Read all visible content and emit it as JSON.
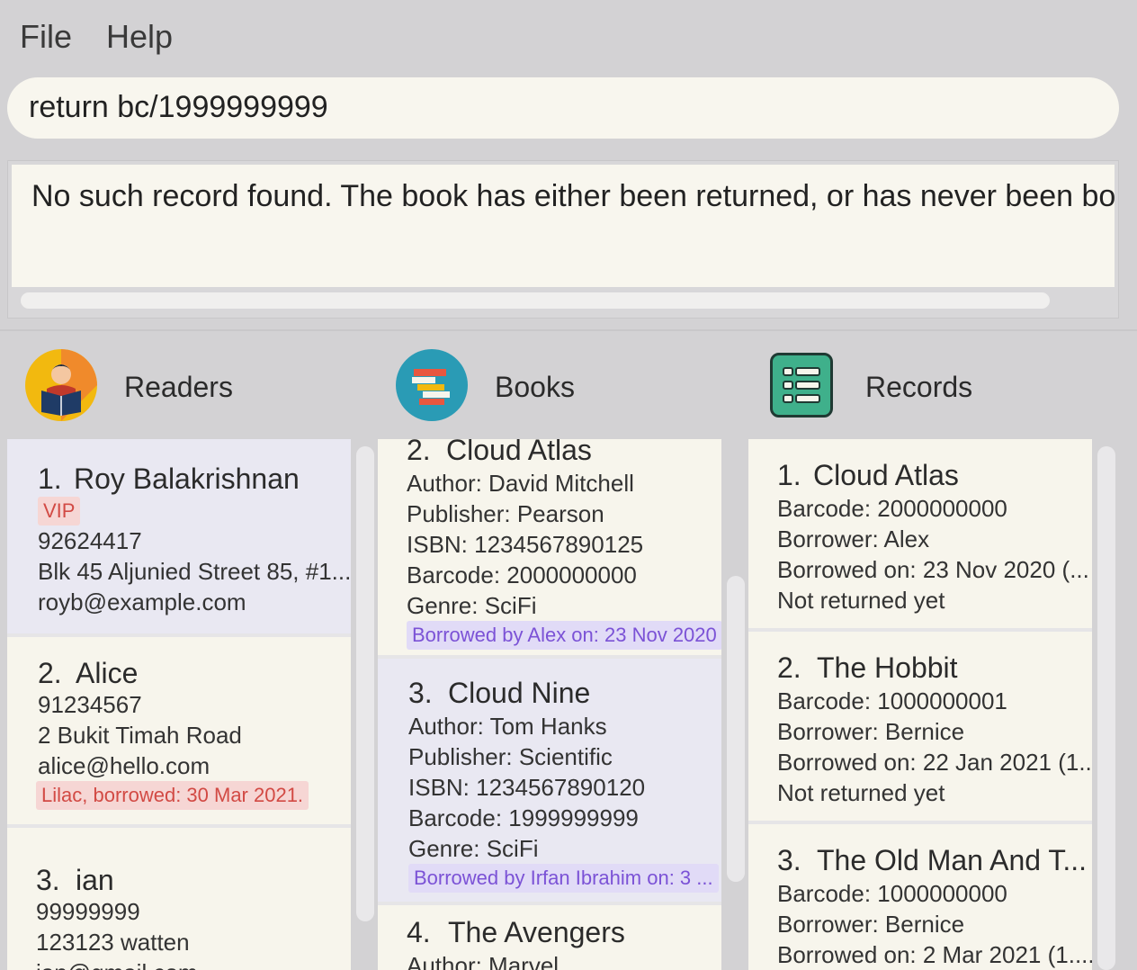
{
  "menu": {
    "file": "File",
    "help": "Help"
  },
  "command": {
    "value": "return bc/1999999999"
  },
  "result": {
    "text": "No such record found. The book has either been returned, or has never been borrowed."
  },
  "panels": {
    "readers": {
      "title": "Readers",
      "icon": "reader-icon"
    },
    "books": {
      "title": "Books",
      "icon": "books-icon"
    },
    "records": {
      "title": "Records",
      "icon": "list-icon"
    }
  },
  "readers": [
    {
      "index": "1.",
      "name": "Roy Balakrishnan",
      "tag": "VIP",
      "phone": "92624417",
      "address": "Blk 45 Aljunied Street 85, #1...",
      "email": "royb@example.com"
    },
    {
      "index": "2.",
      "name": "Alice",
      "phone": "91234567",
      "address": "2 Bukit Timah Road",
      "email": "alice@hello.com",
      "tag": "Lilac, borrowed: 30 Mar 2021."
    },
    {
      "index": "3.",
      "name": "ian",
      "phone": "99999999",
      "address": "123123 watten",
      "email": "ian@gmail.com"
    }
  ],
  "books": [
    {
      "index": "2.",
      "name": "Cloud Atlas",
      "author": "Author: David Mitchell",
      "publisher": "Publisher: Pearson",
      "isbn": "ISBN: 1234567890125",
      "barcode": "Barcode: 2000000000",
      "genre": "Genre: SciFi",
      "status": "Borrowed by Alex on: 23 Nov 2020"
    },
    {
      "index": "3.",
      "name": "Cloud Nine",
      "author": "Author: Tom Hanks",
      "publisher": "Publisher: Scientific",
      "isbn": "ISBN: 1234567890120",
      "barcode": "Barcode: 1999999999",
      "genre": "Genre: SciFi",
      "status": "Borrowed by Irfan Ibrahim on: 3 ..."
    },
    {
      "index": "4.",
      "name": "The Avengers",
      "author": "Author: Marvel"
    }
  ],
  "records": [
    {
      "index": "1.",
      "name": "Cloud Atlas",
      "barcode": "Barcode: 2000000000",
      "borrower": "Borrower: Alex",
      "borrowed": "Borrowed on: 23 Nov 2020 (...",
      "returned": "Not returned yet"
    },
    {
      "index": "2.",
      "name": "The Hobbit",
      "barcode": "Barcode: 1000000001",
      "borrower": "Borrower: Bernice",
      "borrowed": "Borrowed on: 22 Jan 2021 (1...",
      "returned": "Not returned yet"
    },
    {
      "index": "3.",
      "name": "The Old Man And T...",
      "barcode": "Barcode: 1000000000",
      "borrower": "Borrower: Bernice",
      "borrowed": "Borrowed on: 2 Mar 2021 (1...."
    }
  ],
  "colors": {
    "card": "#f7f5ec",
    "selected": "#e9e8f2",
    "tag_red": "#d24a44",
    "tag_purple": "#7b52d6",
    "records_icon": "#3fb08b"
  }
}
